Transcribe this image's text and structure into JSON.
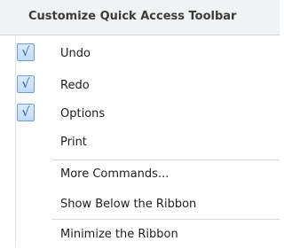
{
  "menu": {
    "title": "Customize Quick Access Toolbar",
    "items": [
      {
        "label": "Undo",
        "checked": true
      },
      {
        "label": "Redo",
        "checked": true
      },
      {
        "label": "Options",
        "checked": true
      },
      {
        "label": "Print",
        "checked": false
      },
      {
        "label": "More Commands..."
      },
      {
        "label": "Show Below the Ribbon"
      },
      {
        "label": "Minimize the Ribbon"
      }
    ],
    "check_glyph": "√",
    "icons": {
      "checkbox": "checkmark-icon"
    },
    "colors": {
      "header_bg": "#f1f2f4",
      "check_border": "#6d9fd8",
      "check_fill": "#c3dbf8",
      "check_mark": "#2a5fa8",
      "separator": "#d9dbde"
    }
  }
}
